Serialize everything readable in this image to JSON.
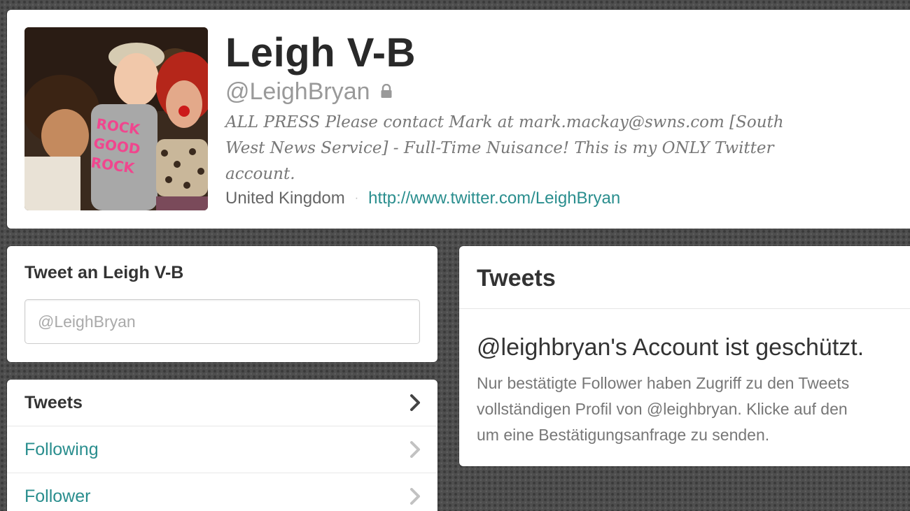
{
  "profile": {
    "fullname": "Leigh V-B",
    "screen_name": "@LeighBryan",
    "bio": "ALL PRESS Please contact Mark at mark.mackay@swns.com [South West News Service] - Full-Time Nuisance! This is my ONLY Twitter account.",
    "location": "United Kingdom",
    "separator": "·",
    "website": "http://www.twitter.com/LeighBryan",
    "protected_icon": "lock-icon",
    "avatar": "profile-photo"
  },
  "tweet_to": {
    "title": "Tweet an Leigh V-B",
    "placeholder": "@LeighBryan"
  },
  "nav": {
    "items": [
      {
        "label": "Tweets",
        "active": true
      },
      {
        "label": "Following",
        "active": false
      },
      {
        "label": "Follower",
        "active": false
      }
    ],
    "chevron_icon": "chevron-right-icon"
  },
  "tweets_panel": {
    "title": "Tweets",
    "protected_heading": "@leighbryan's Account ist geschützt.",
    "protected_message": "Nur bestätigte Follower haben Zugriff zu den Tweets\nvollständigen Profil von @leighbryan. Klicke auf den\num eine Bestätigungsanfrage zu senden."
  },
  "colors": {
    "link": "#2a8e8e",
    "background": "#4e4e4e",
    "card": "#ffffff",
    "muted_text": "#777777"
  }
}
